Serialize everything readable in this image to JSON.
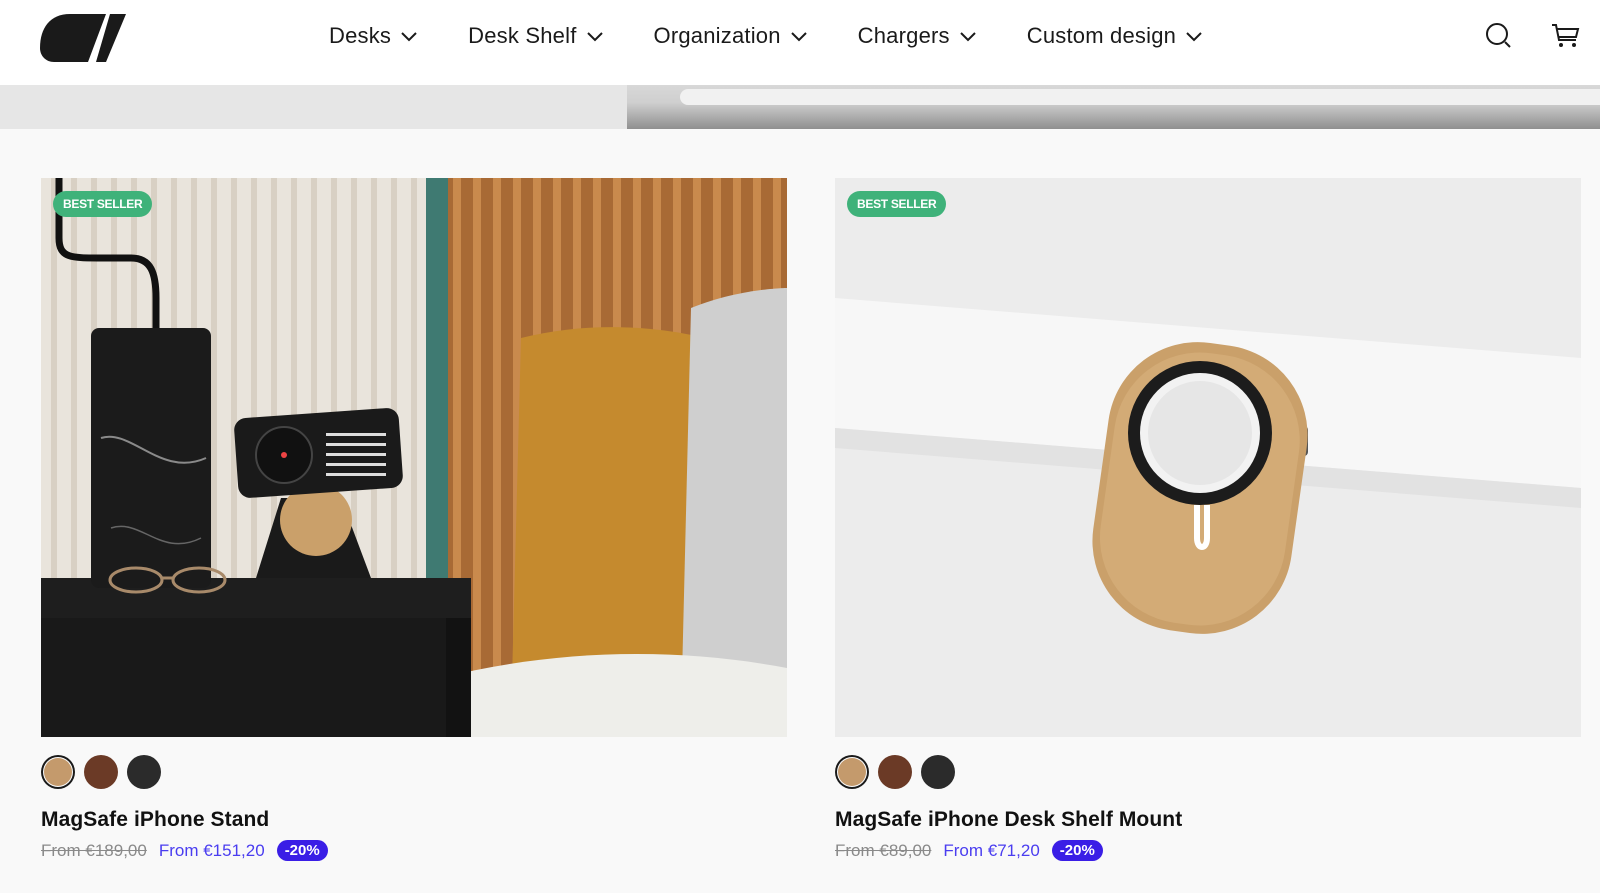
{
  "header": {
    "logo_icon": "brand-logo",
    "nav": [
      {
        "label": "Desks"
      },
      {
        "label": "Desk Shelf"
      },
      {
        "label": "Organization"
      },
      {
        "label": "Chargers"
      },
      {
        "label": "Custom design"
      }
    ],
    "icons": [
      "search-icon",
      "cart-icon"
    ]
  },
  "products": [
    {
      "badge": "BEST SELLER",
      "title": "MagSafe iPhone Stand",
      "price_old": "From €189,00",
      "price_new": "From €151,20",
      "discount": "-20%",
      "swatches": [
        "#c49a6c",
        "#6b3a26",
        "#2b2b2b"
      ],
      "selected_swatch": 0
    },
    {
      "badge": "BEST SELLER",
      "title": "MagSafe iPhone Desk Shelf Mount",
      "price_old": "From €89,00",
      "price_new": "From €71,20",
      "discount": "-20%",
      "swatches": [
        "#c49a6c",
        "#6b3a26",
        "#2b2b2b"
      ],
      "selected_swatch": 0
    }
  ],
  "colors": {
    "badge": "#3fb27a",
    "price_new": "#4a3df0",
    "discount_bg": "#3a1ee6"
  }
}
